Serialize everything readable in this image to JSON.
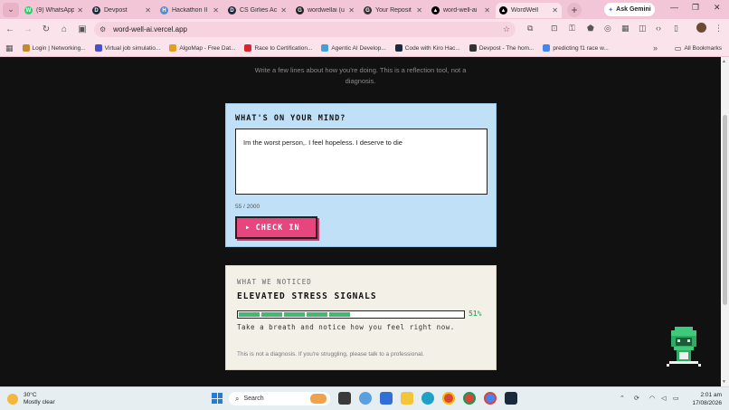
{
  "browser": {
    "tabs": [
      {
        "title": "(9) WhatsApp",
        "fav_color": "#25d366",
        "fav_glyph": "W",
        "active": false
      },
      {
        "title": "Devpost",
        "fav_color": "#1b2a3a",
        "fav_glyph": "D",
        "active": false
      },
      {
        "title": "Hackathon II",
        "fav_color": "#4e8cd9",
        "fav_glyph": "H",
        "active": false
      },
      {
        "title": "CS Girlies Ac",
        "fav_color": "#1b2a3a",
        "fav_glyph": "D",
        "active": false
      },
      {
        "title": "wordwellai (u",
        "fav_color": "#222222",
        "fav_glyph": "G",
        "active": false
      },
      {
        "title": "Your Reposit",
        "fav_color": "#333333",
        "fav_glyph": "G",
        "active": false
      },
      {
        "title": "word-well-ai",
        "fav_color": "#000000",
        "fav_glyph": "▲",
        "active": false
      },
      {
        "title": "WordWell",
        "fav_color": "#000000",
        "fav_glyph": "▲",
        "active": true
      }
    ],
    "new_tab_label": "+",
    "ask_gemini": "Ask Gemini",
    "url": "word-well-ai.vercel.app",
    "bookmarks": [
      {
        "label": "Login | Networking...",
        "color": "#c58a2b"
      },
      {
        "label": "Virtual job simulatio...",
        "color": "#4a4fd1"
      },
      {
        "label": "AlgoMap - Free Dat...",
        "color": "#e0a020"
      },
      {
        "label": "Race to Certification...",
        "color": "#d8262e"
      },
      {
        "label": "Agentic AI Develop...",
        "color": "#43a0d8"
      },
      {
        "label": "Code with Kiro Hac...",
        "color": "#1b2a3a"
      },
      {
        "label": "Devpost - The hom...",
        "color": "#333333"
      },
      {
        "label": "predicting f1 race w...",
        "color": "#4285f4"
      }
    ],
    "all_bookmarks": "All Bookmarks"
  },
  "page": {
    "intro_line1": "Write a few lines about how you're doing. This is a reflection tool, not a",
    "intro_line2": "diagnosis.",
    "mind": {
      "title": "WHAT'S ON YOUR MIND?",
      "text": "Im the worst person,. I feel hopeless. I deserve to die",
      "counter": "55 / 2000",
      "button": "CHECK IN"
    },
    "noticed": {
      "label": "WHAT WE NOTICED",
      "heading": "ELEVATED STRESS SIGNALS",
      "level_percent": 51,
      "level_label": "51%",
      "meter_segments_total": 10,
      "tip": "Take a breath and notice how you feel right now.",
      "disclaimer": "This is not a diagnosis. If you're struggling, please talk to a professional."
    },
    "accent_pink": "#e6457d",
    "accent_green": "#43b874",
    "card_blue": "#bfe0f7"
  },
  "taskbar": {
    "temperature": "30°C",
    "weather": "Mostly clear",
    "search_placeholder": "Search",
    "time": "2:01 am",
    "date": "17/08/2026"
  }
}
